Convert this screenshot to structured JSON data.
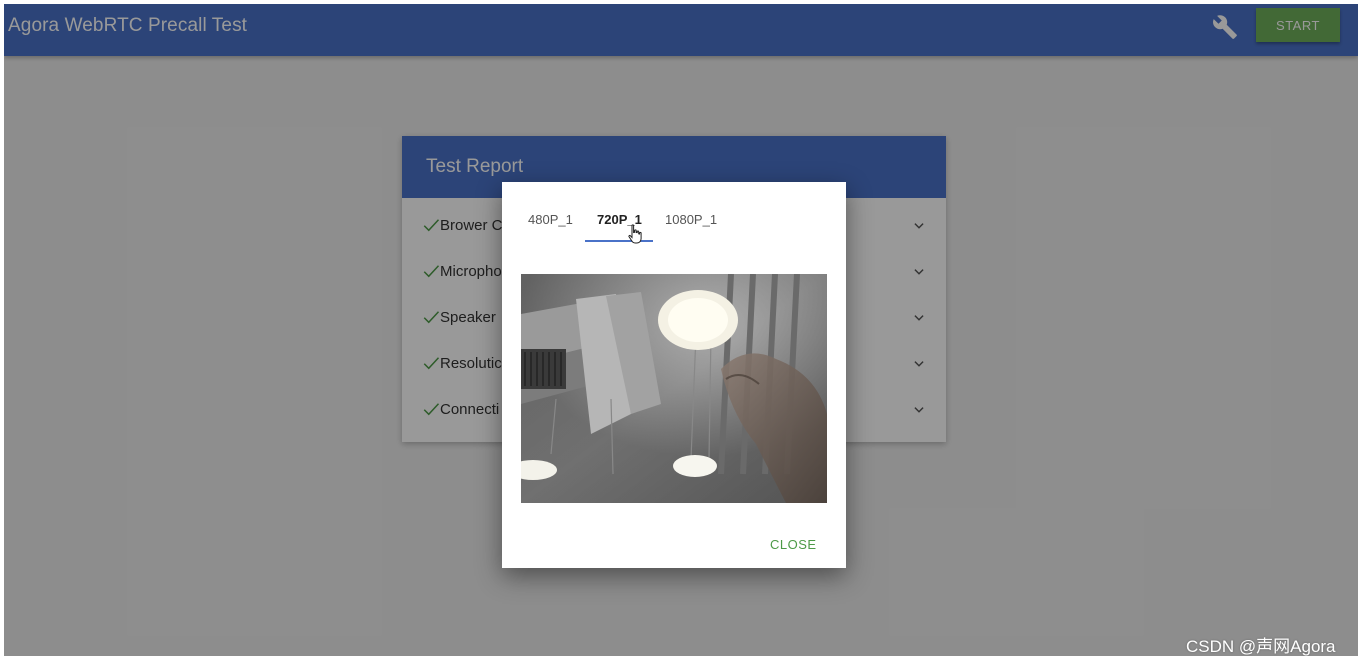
{
  "appbar": {
    "title": "Agora WebRTC Precall Test",
    "start_label": "START",
    "settings_icon": "wrench-icon"
  },
  "report": {
    "title": "Test Report",
    "rows": [
      {
        "label": "Brower C"
      },
      {
        "label": "Micropho"
      },
      {
        "label": "Speaker"
      },
      {
        "label": "Resolutic"
      },
      {
        "label": "Connecti"
      }
    ]
  },
  "dialog": {
    "tabs": [
      {
        "label": "480P_1",
        "active": false
      },
      {
        "label": "720P_1",
        "active": true
      },
      {
        "label": "1080P_1",
        "active": false
      }
    ],
    "close_label": "CLOSE"
  },
  "watermark": "CSDN @声网Agora",
  "colors": {
    "primary": "#4a72c8",
    "start_button": "#6fb05a",
    "check": "#4d9a47"
  }
}
